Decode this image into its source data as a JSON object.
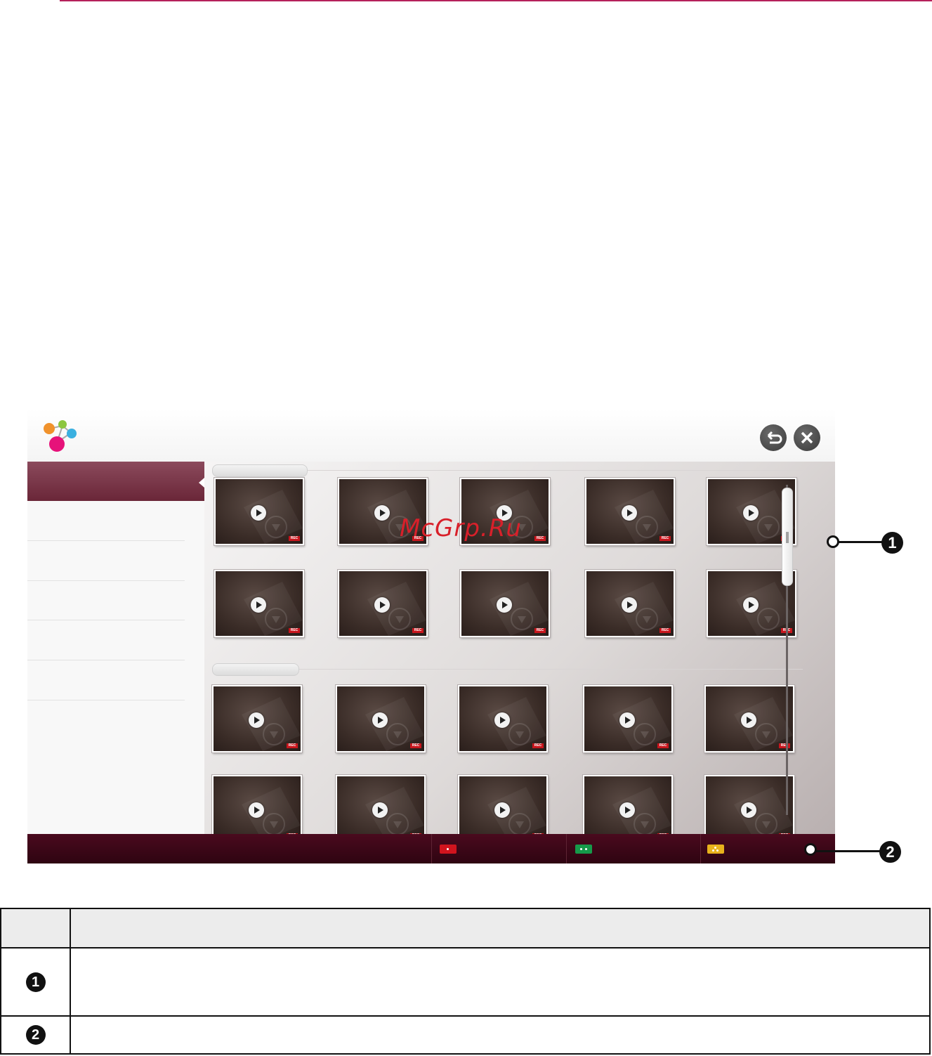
{
  "watermark": "McGrp.Ru",
  "callouts": [
    "1",
    "2"
  ],
  "footer_keys": [
    {
      "color": "#d0141e",
      "icon": "red-key-icon"
    },
    {
      "color": "#169a4a",
      "icon": "green-key-icon"
    },
    {
      "color": "#e8b21c",
      "icon": "yellow-key-icon"
    }
  ],
  "table": {
    "rows": [
      {
        "num": "1"
      },
      {
        "num": "2"
      }
    ]
  },
  "thumbnails": {
    "badge": "REC"
  }
}
